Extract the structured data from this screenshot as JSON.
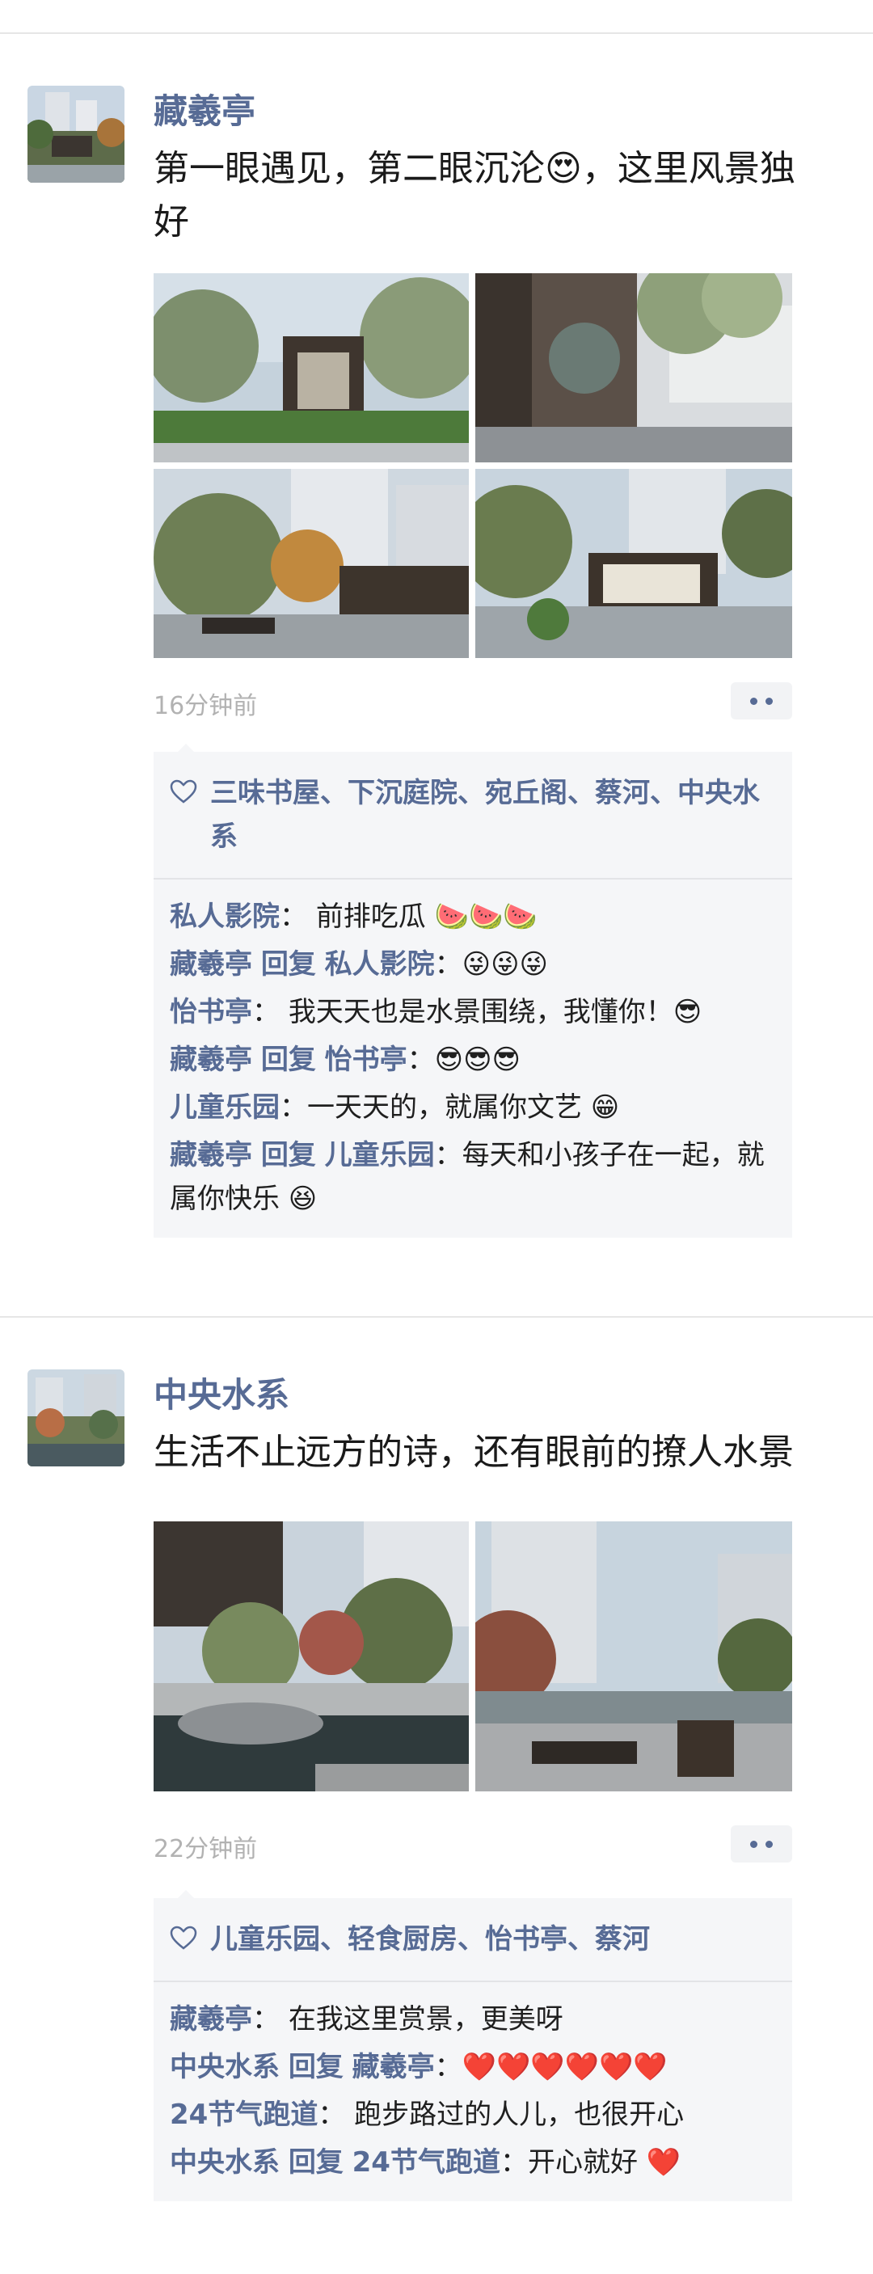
{
  "posts": [
    {
      "author": "藏羲亭",
      "text": "第一眼遇见，第二眼沉沦😍，这里风景独好",
      "time": "16分钟前",
      "likes": "三味书屋、下沉庭院、宛丘阁、蔡河、中央水系",
      "comments": [
        {
          "name": "私人影院",
          "reply_to": "",
          "text": "前排吃瓜 🍉🍉🍉"
        },
        {
          "name": "藏羲亭",
          "reply_to": "私人影院",
          "text": "😜😜😜"
        },
        {
          "name": "怡书亭",
          "reply_to": "",
          "text": "我天天也是水景围绕，我懂你！😎"
        },
        {
          "name": "藏羲亭",
          "reply_to": "怡书亭",
          "text": "😎😎😎"
        },
        {
          "name": "儿童乐园",
          "reply_to": "",
          "text": "一天天的，就属你文艺 😁"
        },
        {
          "name": "藏羲亭",
          "reply_to": "儿童乐园",
          "text": "每天和小孩子在一起，就属你快乐 😆"
        }
      ]
    },
    {
      "author": "中央水系",
      "text": "生活不止远方的诗，还有眼前的撩人水景",
      "time": "22分钟前",
      "likes": "儿童乐园、轻食厨房、怡书亭、蔡河",
      "comments": [
        {
          "name": "藏羲亭",
          "reply_to": "",
          "text": "在我这里赏景，更美呀"
        },
        {
          "name": "中央水系",
          "reply_to": "藏羲亭",
          "text": "❤️❤️❤️❤️❤️❤️"
        },
        {
          "name": "24节气跑道",
          "reply_to": "",
          "text": "跑步路过的人儿，也很开心"
        },
        {
          "name": "中央水系",
          "reply_to": "24节气跑道",
          "text": "开心就好 ❤️"
        }
      ]
    }
  ],
  "labels": {
    "reply": "回复",
    "colon": "："
  },
  "colors": {
    "link": "#576b95",
    "panel": "#f5f6f8",
    "time": "#b2b2b2"
  }
}
